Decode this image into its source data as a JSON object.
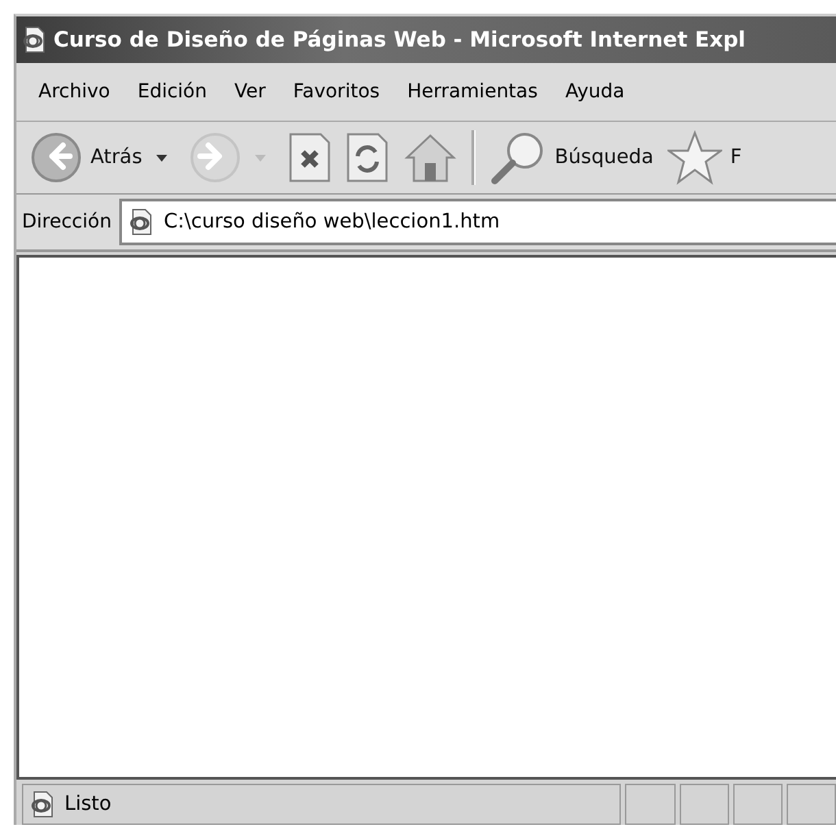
{
  "window": {
    "title": "Curso de Diseño de Páginas Web - Microsoft Internet Expl"
  },
  "menu": [
    "Archivo",
    "Edición",
    "Ver",
    "Favoritos",
    "Herramientas",
    "Ayuda"
  ],
  "toolbar": [
    {
      "kind": "back",
      "label": "Atrás",
      "disabled": false
    },
    {
      "kind": "forward",
      "disabled": true
    },
    {
      "kind": "stop"
    },
    {
      "kind": "refresh"
    },
    {
      "kind": "home"
    },
    {
      "kind": "separator"
    },
    {
      "kind": "search",
      "label": "Búsqueda"
    },
    {
      "kind": "favorites",
      "label": "F"
    }
  ],
  "address": {
    "label": "Dirección",
    "value": "C:\\curso diseño web\\leccion1.htm"
  },
  "status_bar": {
    "text": "Listo"
  }
}
